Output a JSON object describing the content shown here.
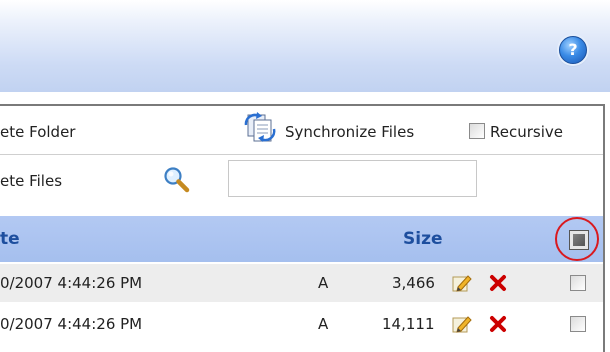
{
  "help": {
    "icon": "help-icon",
    "glyph": "?"
  },
  "toolbar": {
    "delete_folder_label": "ete Folder",
    "synchronize_label": "Synchronize Files",
    "recursive_label": "Recursive",
    "delete_files_label": "ete Files",
    "search_value": ""
  },
  "grid": {
    "columns": {
      "date": "te",
      "size": "Size"
    },
    "rows": [
      {
        "date": "0/2007 4:44:26 PM",
        "attr": "A",
        "size": "3,466"
      },
      {
        "date": "0/2007 4:44:26 PM",
        "attr": "A",
        "size": "14,111"
      }
    ]
  },
  "colors": {
    "header_text": "#1d4e9e",
    "row_alt_bg": "#ededed",
    "highlight_circle": "#d9191f",
    "delete_icon": "#cc0000"
  }
}
